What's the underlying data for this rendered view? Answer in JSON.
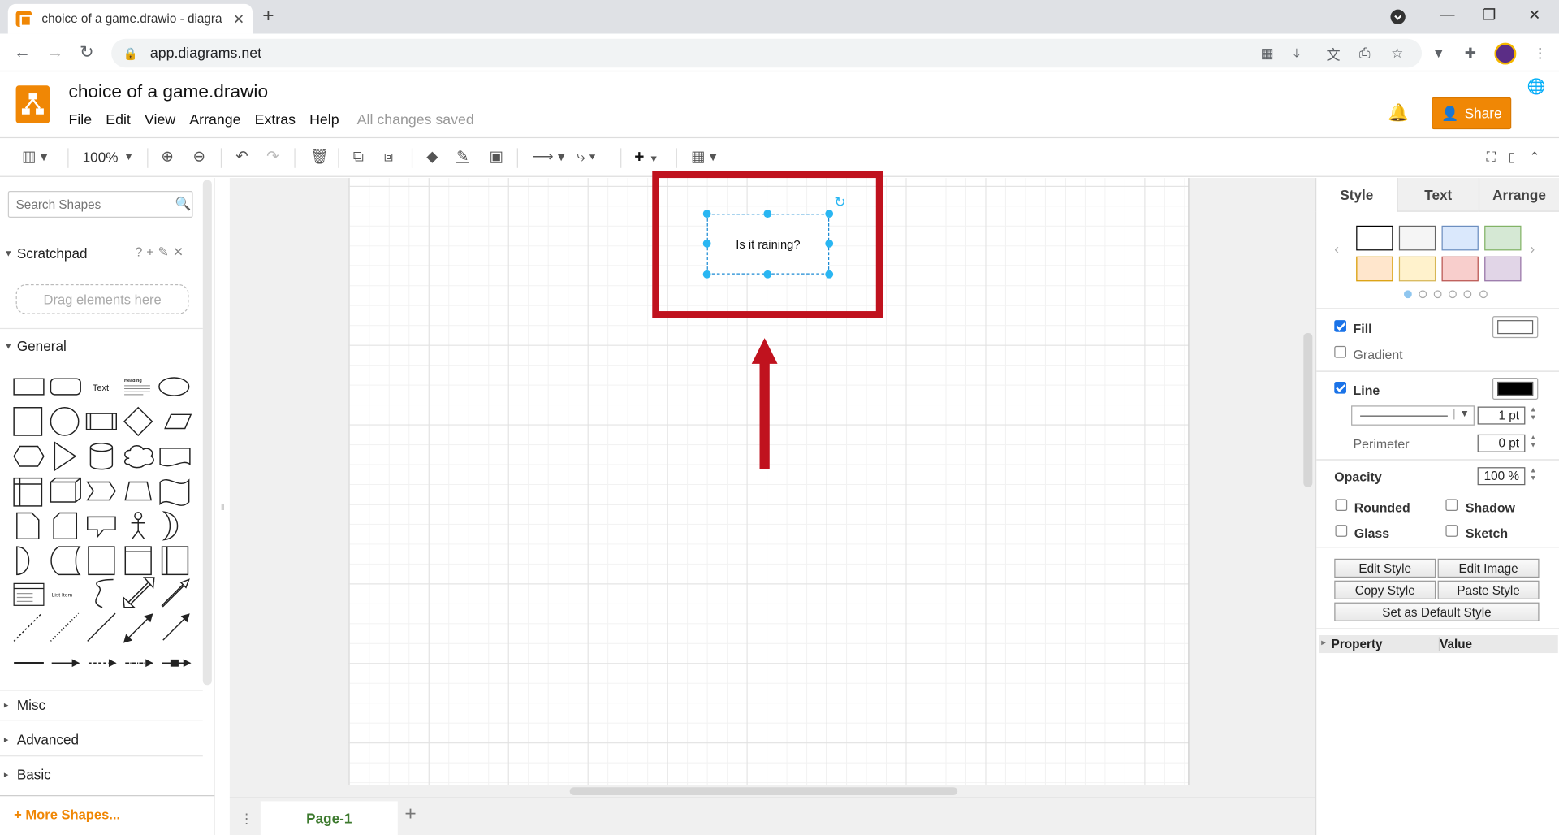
{
  "browser": {
    "tab_title": "choice of a game.drawio - diagra",
    "tab_close": "✕",
    "new_tab": "+",
    "url": "app.diagrams.net"
  },
  "app": {
    "filename": "choice of a game.drawio",
    "menu": [
      "File",
      "Edit",
      "View",
      "Arrange",
      "Extras",
      "Help"
    ],
    "save_status": "All changes saved",
    "share_label": "Share"
  },
  "toolbar": {
    "zoom": "100%"
  },
  "sidebar": {
    "search_placeholder": "Search Shapes",
    "scratchpad_title": "Scratchpad",
    "scratchpad_icons": "?+✎✕",
    "drag_hint": "Drag elements here",
    "general_title": "General",
    "shape_text_label": "Text",
    "shape_heading_label": "Heading",
    "shape_listitem_label": "List Item",
    "sections_collapsed": [
      "Misc",
      "Advanced",
      "Basic"
    ],
    "more_shapes": "More Shapes..."
  },
  "canvas": {
    "shape_text": "Is it raining?",
    "page_tab": "Page-1"
  },
  "format_panel": {
    "tabs": [
      "Style",
      "Text",
      "Arrange"
    ],
    "swatch_colors": [
      "#ffffff",
      "#f5f5f5",
      "#dae8fc",
      "#d5e8d4",
      "#ffe6cc",
      "#fff2cc",
      "#f8cecc",
      "#e1d5e7"
    ],
    "swatch_borders": [
      "#000000",
      "#666666",
      "#6c8ebf",
      "#82b366",
      "#d79b00",
      "#d6b656",
      "#b85450",
      "#9673a6"
    ],
    "fill_label": "Fill",
    "fill_checked": true,
    "fill_color": "#ffffff",
    "gradient_label": "Gradient",
    "gradient_checked": false,
    "line_label": "Line",
    "line_checked": true,
    "line_color": "#000000",
    "line_width": "1 pt",
    "perimeter_label": "Perimeter",
    "perimeter_value": "0 pt",
    "opacity_label": "Opacity",
    "opacity_value": "100 %",
    "rounded_label": "Rounded",
    "shadow_label": "Shadow",
    "glass_label": "Glass",
    "sketch_label": "Sketch",
    "edit_style": "Edit Style",
    "edit_image": "Edit Image",
    "copy_style": "Copy Style",
    "paste_style": "Paste Style",
    "set_default": "Set as Default Style",
    "property_header": "Property",
    "value_header": "Value"
  },
  "colors": {
    "accent": "#f08705",
    "selection": "#29b6f2",
    "annotation_red": "#c0121e"
  }
}
